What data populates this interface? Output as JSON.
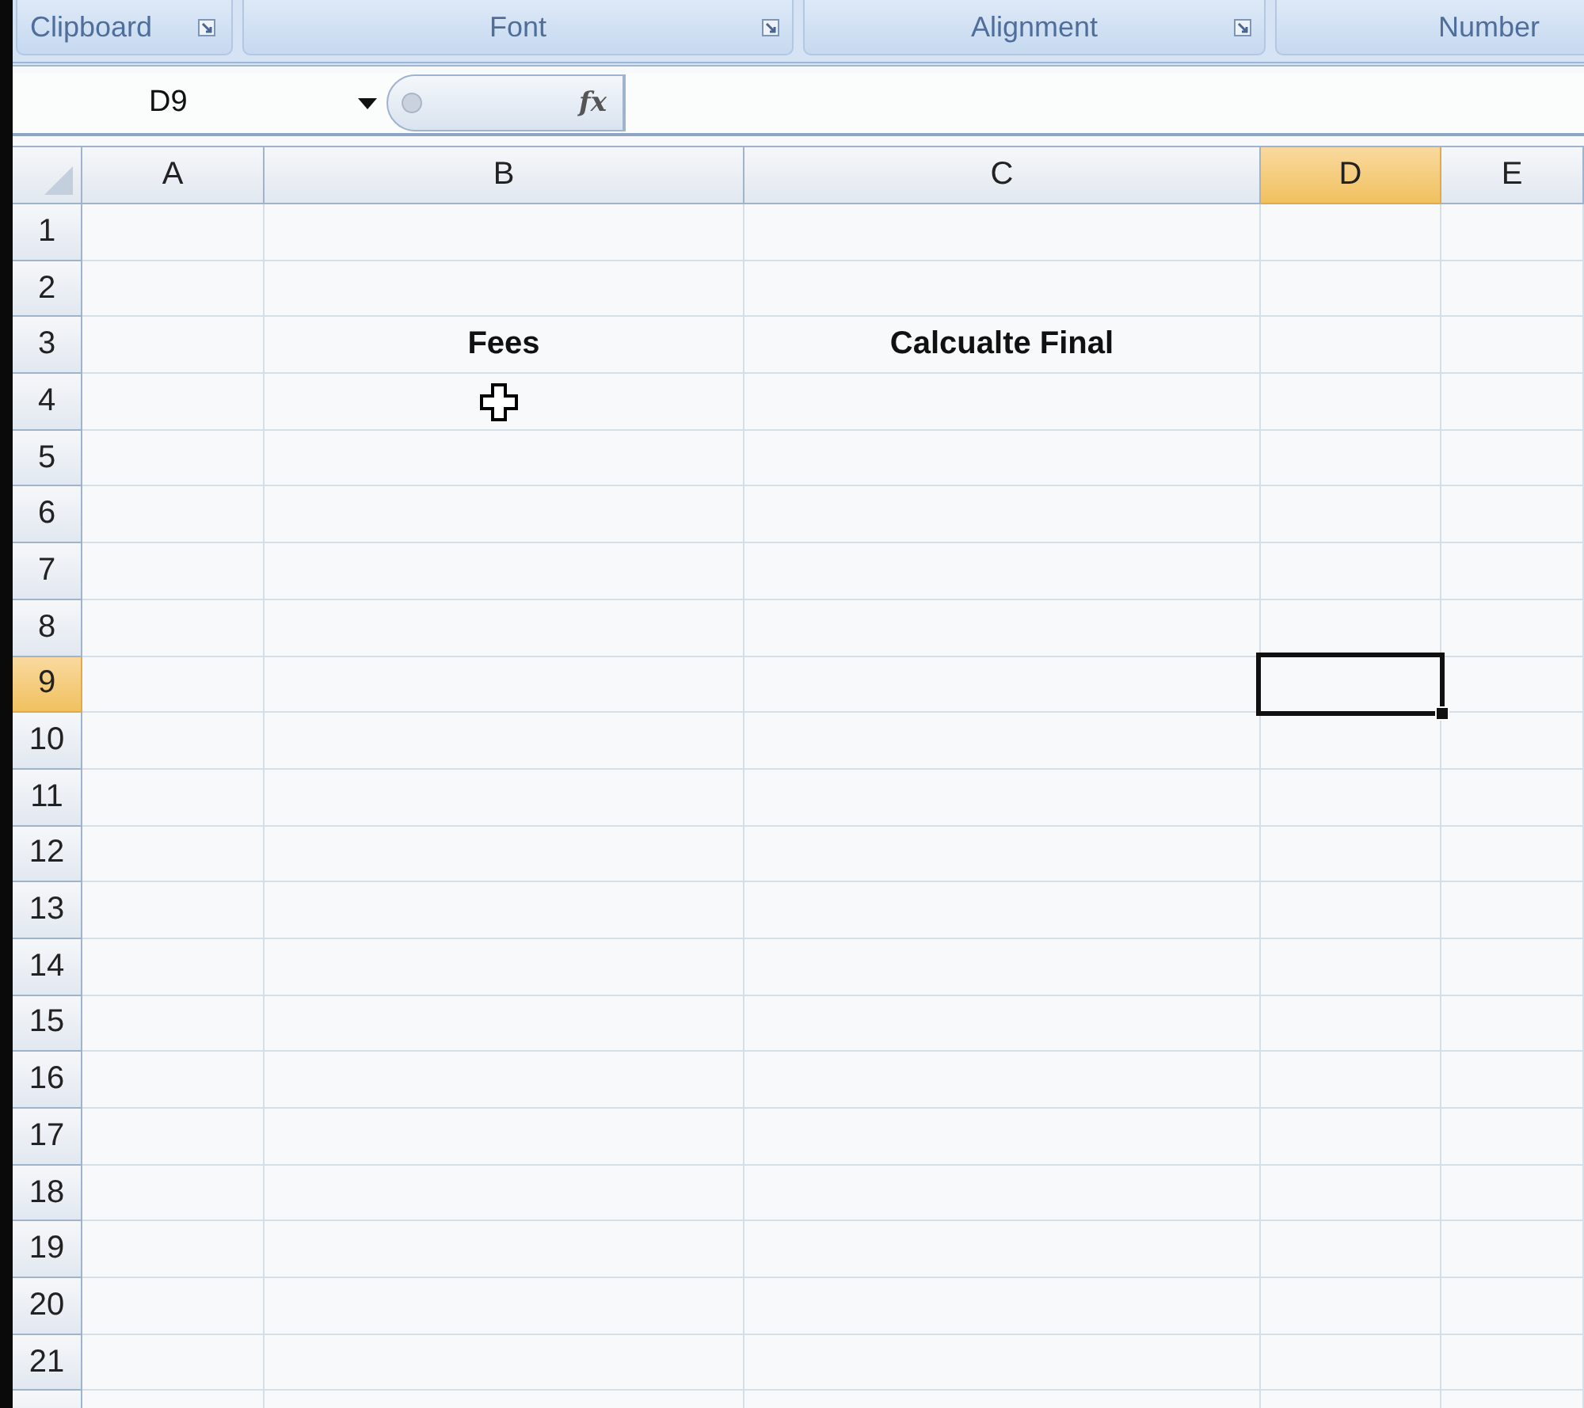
{
  "ribbon_groups": [
    {
      "label": "Clipboard"
    },
    {
      "label": "Font"
    },
    {
      "label": "Alignment"
    },
    {
      "label": "Number"
    }
  ],
  "name_box": {
    "value": "D9"
  },
  "formula_bar": {
    "function_label": "fx"
  },
  "columns": [
    {
      "label": "A",
      "selected": false
    },
    {
      "label": "B",
      "selected": false
    },
    {
      "label": "C",
      "selected": false
    },
    {
      "label": "D",
      "selected": true
    },
    {
      "label": "E",
      "selected": false
    }
  ],
  "rows": [
    {
      "label": "1",
      "selected": false
    },
    {
      "label": "2",
      "selected": false
    },
    {
      "label": "3",
      "selected": false,
      "cells": [
        null,
        "Fees",
        "Calcualte Final",
        null,
        null
      ]
    },
    {
      "label": "4",
      "selected": false
    },
    {
      "label": "5",
      "selected": false
    },
    {
      "label": "6",
      "selected": false
    },
    {
      "label": "7",
      "selected": false
    },
    {
      "label": "8",
      "selected": false
    },
    {
      "label": "9",
      "selected": true
    },
    {
      "label": "10",
      "selected": false
    },
    {
      "label": "11",
      "selected": false
    },
    {
      "label": "12",
      "selected": false
    },
    {
      "label": "13",
      "selected": false
    },
    {
      "label": "14",
      "selected": false
    },
    {
      "label": "15",
      "selected": false
    },
    {
      "label": "16",
      "selected": false
    },
    {
      "label": "17",
      "selected": false
    },
    {
      "label": "18",
      "selected": false
    },
    {
      "label": "19",
      "selected": false
    },
    {
      "label": "20",
      "selected": false
    },
    {
      "label": "21",
      "selected": false
    }
  ]
}
